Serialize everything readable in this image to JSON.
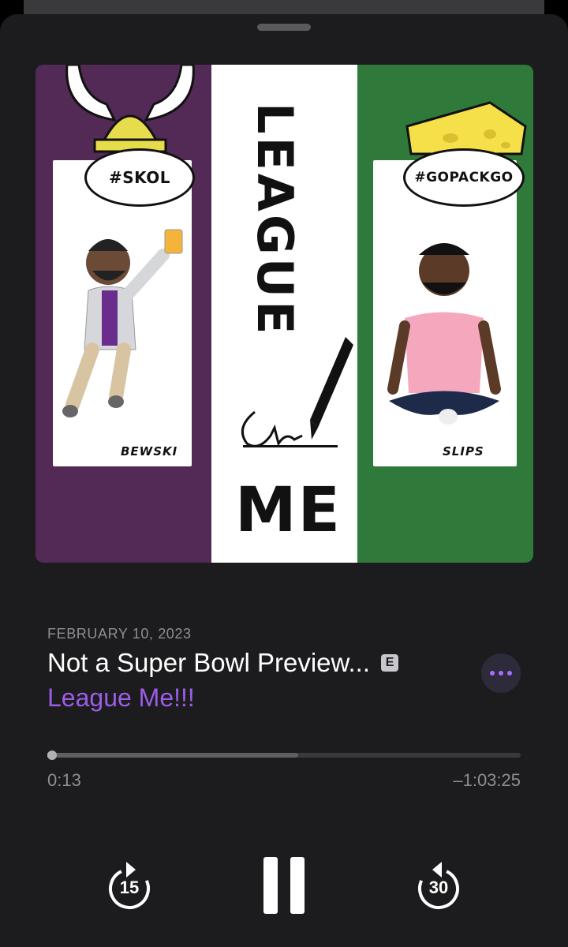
{
  "episode": {
    "date": "FEBRUARY 10, 2023",
    "title": "Not a Super Bowl Preview...",
    "explicit_badge": "E",
    "show_name": "League Me!!!"
  },
  "artwork": {
    "left_hashtag": "#SKOL",
    "right_hashtag": "#GOPACKGO",
    "league_text": "LEAGUE",
    "me_text": "ME",
    "left_signature": "BEWSKI",
    "right_signature": "SLIPS",
    "colors": {
      "purple": "#522a55",
      "green": "#2f7a3a"
    }
  },
  "progress": {
    "elapsed": "0:13",
    "remaining": "–1:03:25",
    "played_fraction": 0.003,
    "buffered_fraction": 0.53
  },
  "controls": {
    "skip_back_label": "15",
    "skip_forward_label": "30",
    "play_state": "pause-icon",
    "more_icon": "ellipsis-icon",
    "accent": "#9b5de5"
  }
}
